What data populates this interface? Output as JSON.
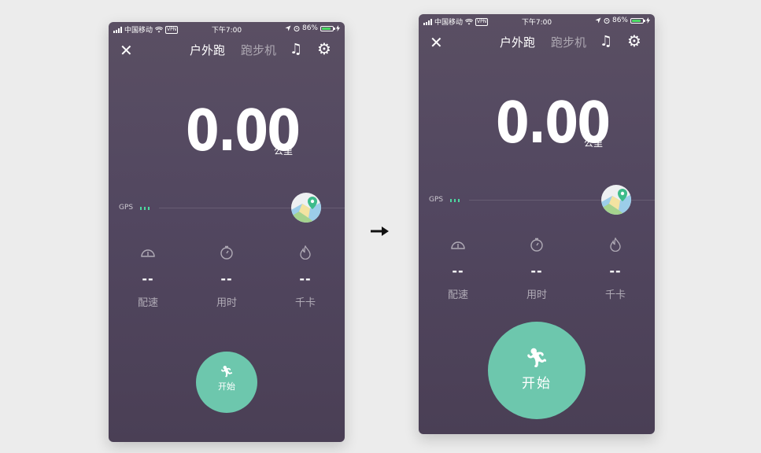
{
  "status_bar": {
    "carrier": "中国移动",
    "vpn": "VPN",
    "time": "下午7:00",
    "battery": "86%",
    "battery_level": 0.86
  },
  "nav": {
    "close_icon": "close-icon",
    "tab_outdoor": "户外跑",
    "tab_treadmill": "跑步机",
    "music_icon": "music-icon",
    "settings_icon": "gear-icon"
  },
  "distance": {
    "value": "0.00",
    "unit": "公里"
  },
  "gps": {
    "label": "GPS"
  },
  "stats": [
    {
      "icon": "speedometer-icon",
      "value": "--",
      "label": "配速"
    },
    {
      "icon": "stopwatch-icon",
      "value": "--",
      "label": "用时"
    },
    {
      "icon": "flame-icon",
      "value": "--",
      "label": "千卡"
    }
  ],
  "start_button": {
    "label": "开始",
    "icon": "running-man-icon"
  },
  "colors": {
    "accent": "#6dc7ad",
    "background": "#524760",
    "gps_signal": "#4cd9a0"
  }
}
